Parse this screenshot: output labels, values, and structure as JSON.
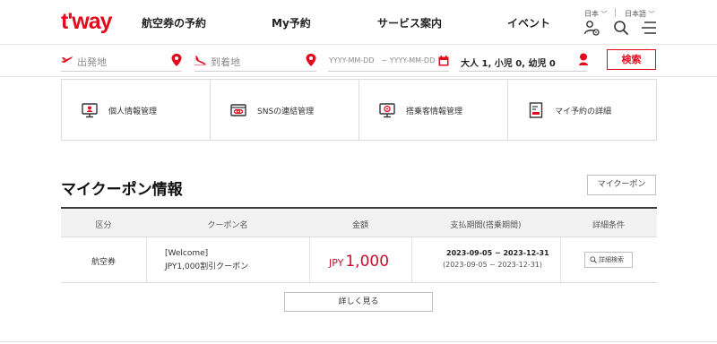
{
  "brand": {
    "logo": "t'way",
    "accent": "#e30a1e"
  },
  "nav": {
    "items": [
      "航空券の予約",
      "My予約",
      "サービス案内",
      "イベント"
    ]
  },
  "lang": {
    "country": "日本",
    "language": "日本語"
  },
  "icons": {
    "user": "user-settings-icon",
    "search": "search-icon",
    "menu": "menu-icon"
  },
  "search": {
    "origin_placeholder": "出発地",
    "destination_placeholder": "到着地",
    "date_placeholder": "YYYY-MM-DD　~ YYYY-MM-DD",
    "passengers": "大人 1, 小児 0, 幼児 0",
    "button": "検索"
  },
  "quickmenu": {
    "items": [
      {
        "label": "個人情報管理",
        "icon": "monitor-user-icon"
      },
      {
        "label": "SNSの連結管理",
        "icon": "link-card-icon"
      },
      {
        "label": "搭乗客情報管理",
        "icon": "monitor-passenger-icon"
      },
      {
        "label": "マイ予約の詳細",
        "icon": "document-list-icon"
      }
    ]
  },
  "coupon": {
    "title": "マイクーポン情報",
    "mycoupon_button": "マイクーポン",
    "headers": [
      "区分",
      "クーポン名",
      "金額",
      "支払期間(搭乗期間)",
      "詳細条件"
    ],
    "rows": [
      {
        "category": "航空券",
        "name_line1": "[Welcome]",
        "name_line2": "JPY1,000割引クーポン",
        "currency": "JPY",
        "amount": "1,000",
        "period_pay": "2023-09-05 ~ 2023-12-31",
        "period_board": "(2023-09-05 ~ 2023-12-31)",
        "detail_button": "詳細検索"
      }
    ],
    "more_button": "詳しく見る"
  }
}
